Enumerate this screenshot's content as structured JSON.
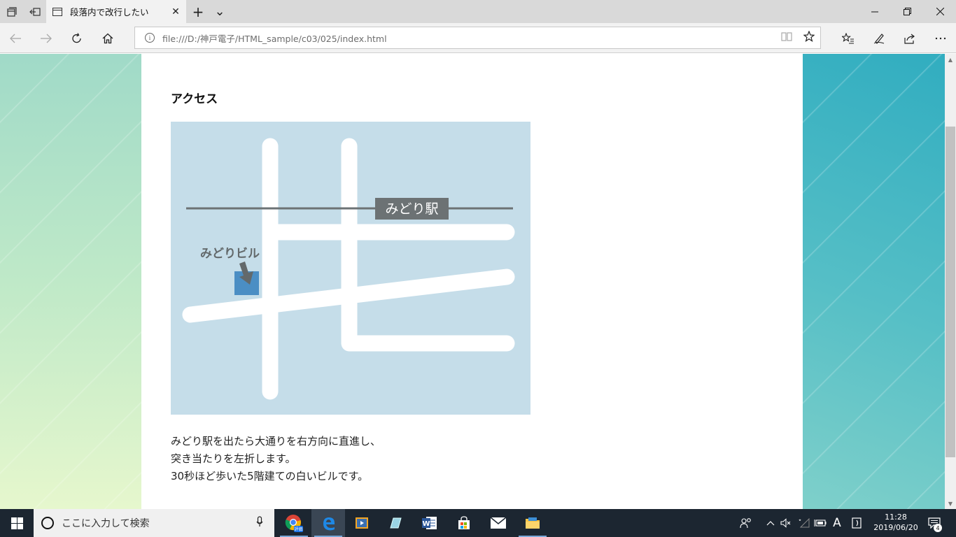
{
  "browser": {
    "tab_title": "段落内で改行したい",
    "tab_close": "✕",
    "new_tab": "+",
    "tab_list": "⌄",
    "address": "file:///D:/神戸電子/HTML_sample/c03/025/index.html",
    "info_glyph": "i"
  },
  "page": {
    "heading": "アクセス",
    "map": {
      "station_label": "みどり駅",
      "building_label": "みどりビル"
    },
    "paragraph_lines": [
      "みどり駅を出たら大通りを右方向に直進し、",
      "突き当たりを左折します。",
      "30秒ほど歩いた5階建ての白いビルです。"
    ]
  },
  "taskbar": {
    "search_placeholder": "ここに入力して検索",
    "chrome_badge": "評価",
    "ime_indicator": "A",
    "time": "11:28",
    "date": "2019/06/20",
    "notification_count": "4"
  },
  "colors": {
    "map_bg": "#c5dde9",
    "road": "#ffffff",
    "rail": "#6c7274",
    "building": "#4b8ec4",
    "arrow": "#63696b"
  }
}
